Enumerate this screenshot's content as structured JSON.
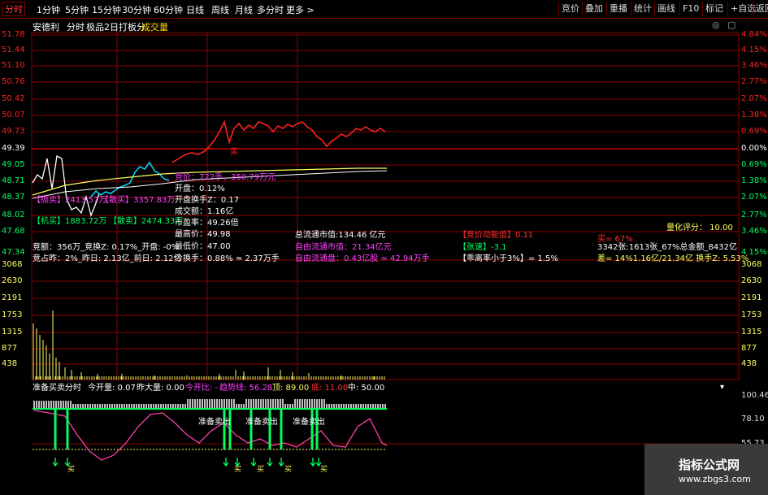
{
  "toolbar": {
    "periods": [
      "分时",
      "1分钟",
      "5分钟",
      "15分钟",
      "30分钟",
      "60分钟",
      "日线",
      "周线",
      "月线",
      "多分时",
      "更多 >"
    ],
    "active": "分时",
    "right_buttons": [
      "竞价",
      "叠加",
      "重播",
      "统计",
      "画线",
      "F10",
      "标记",
      "+自选",
      "返回"
    ]
  },
  "header": {
    "stock": "安德利",
    "view": "分时",
    "indicator": "极品2日打板分",
    "volume_label": "成交量"
  },
  "price_axis_left": [
    "51.78",
    "51.44",
    "51.10",
    "50.76",
    "50.42",
    "50.07",
    "49.73",
    "49.39",
    "49.05",
    "48.71",
    "48.37",
    "48.02",
    "47.68",
    "47.34"
  ],
  "price_axis_right": [
    "4.84%",
    "4.15%",
    "3.46%",
    "2.77%",
    "2.07%",
    "1.38%",
    "0.69%",
    "0.00%",
    "0.69%",
    "1.38%",
    "2.07%",
    "2.77%",
    "3.46%",
    "4.15%"
  ],
  "volume_axis": [
    "3068",
    "2630",
    "2191",
    "1753",
    "1315",
    "877",
    "438"
  ],
  "osc_axis": [
    "100.46",
    "78.10",
    "55.73"
  ],
  "overlay": {
    "auction_price": "竞价：722手，350.79万元",
    "open": "开盘：0.12%",
    "open_turnover": "开盘换手Z：0.17",
    "amount": "成交额：1.16亿",
    "pe": "市盈率：49.26倍",
    "high": "最高价：49.98",
    "low": "最低价：47.00",
    "turnover": "今换手：0.88%  ≈ 2.37万手",
    "buy_pressure": "【抛卖】2413.57万",
    "sell_pressure": "【散买】3357.83万",
    "buy_force": "【机买】1883.72万",
    "sell_force": "【散卖】2474.33万",
    "market_cap": "总流通市值:134.46 亿元",
    "free_cap": "自由流通市值：21.34亿元",
    "free_share": "自由流通盘：0.43亿股 ≈ 42.94万手",
    "auction_kinetic": "【竞价动能值】0.11",
    "rise_speed": "【张速】-3.1",
    "deviation": "【乖离率小于3%】= 1.5%",
    "score": "量化评分： 10.00",
    "buy_pct": "买= 67%",
    "stat_line": "3342张:1613张_67%总金额_8432亿",
    "diff_line": "差= 14%1.16亿/21.34亿 换手Z: 5.53%",
    "auction_vol": "竞额：356万_竞换Z: 0.17%_开盘: -0%",
    "prev_ratio": "竞占昨：2%_昨日: 2.13亿_前日: 2.12亿"
  },
  "oscillator": {
    "title": "准备买卖分时",
    "today_open": "今开量: 0.07",
    "yest_vol": "昨大量: 0.00",
    "open_ratio": "今开比: -",
    "trend": "趋势线: 56.28",
    "top": "顶: 89.00",
    "bottom": "底: 11.00",
    "mid": "中: 50.00",
    "sell_label": "准备卖出",
    "buy_label": "买"
  },
  "watermark": {
    "title": "指标公式网",
    "url": "www.zbgs3.com"
  },
  "colors": {
    "grid": "#8a0000",
    "up": "#ff2020",
    "down": "#00e0ff",
    "avg": "#ffff60",
    "white": "#ffffff"
  }
}
